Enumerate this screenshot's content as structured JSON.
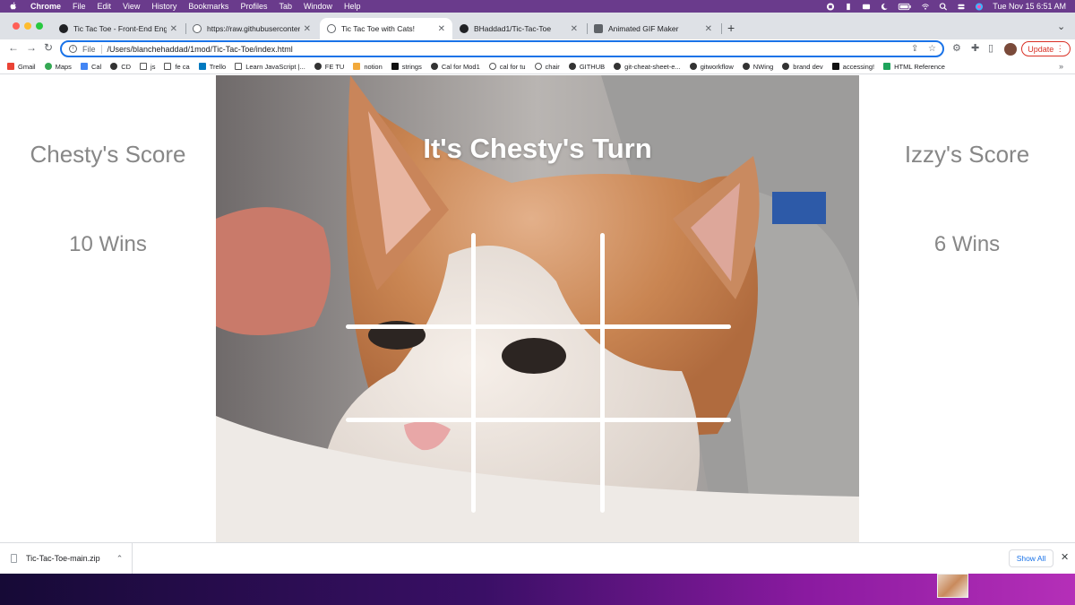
{
  "menubar": {
    "items": [
      "Chrome",
      "File",
      "Edit",
      "View",
      "History",
      "Bookmarks",
      "Profiles",
      "Tab",
      "Window",
      "Help"
    ],
    "datetime": "Tue Nov 15  6:51 AM"
  },
  "tabs": [
    {
      "title": "Tic Tac Toe - Front-End Engine",
      "active": false
    },
    {
      "title": "https://raw.githubusercontent.",
      "active": false
    },
    {
      "title": "Tic Tac Toe with Cats!",
      "active": true
    },
    {
      "title": "BHaddad1/Tic-Tac-Toe",
      "active": false
    },
    {
      "title": "Animated GIF Maker",
      "active": false
    }
  ],
  "omnibox": {
    "scheme_label": "File",
    "url": "/Users/blanchehaddad/1mod/Tic-Tac-Toe/index.html"
  },
  "toolbar": {
    "update_label": "Update"
  },
  "bookmarks": [
    "Gmail",
    "Maps",
    "Cal",
    "CD",
    "js",
    "fe ca",
    "Trello",
    "Learn JavaScript |...",
    "FE TU",
    "notion",
    "strings",
    "Cal for Mod1",
    "cal for tu",
    "chair",
    "GITHUB",
    "git-cheat-sheet-e...",
    "gitworkflow",
    "NWing",
    "brand dev",
    "accessing!",
    "HTML Reference"
  ],
  "game": {
    "turn_text": "It's Chesty's Turn",
    "players": [
      {
        "score_title": "Chesty's Score",
        "wins": "10 Wins"
      },
      {
        "score_title": "Izzy's Score",
        "wins": "6 Wins"
      }
    ]
  },
  "download_shelf": {
    "file_name": "Tic-Tac-Toe-main.zip",
    "show_all_label": "Show All"
  },
  "colors": {
    "active_tab_border": "#1a73e8",
    "score_text": "#878787",
    "update_red": "#d93025",
    "grid_line": "#ffffff"
  }
}
